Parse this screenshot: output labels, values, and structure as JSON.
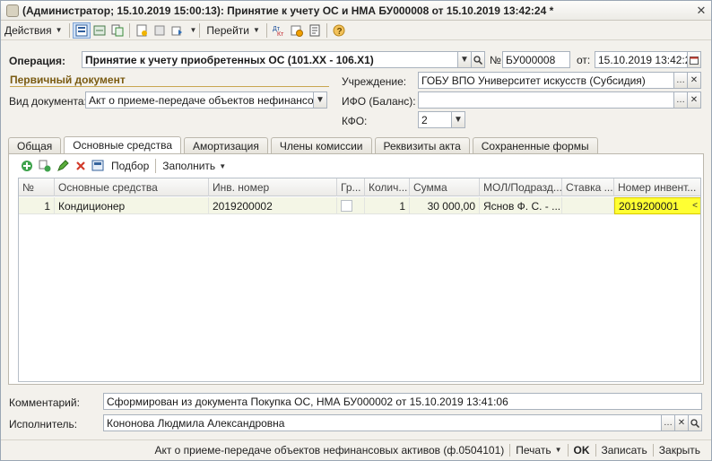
{
  "window": {
    "title": "(Администратор; 15.10.2019 15:00:13): Принятие к учету ОС и НМА БУ000008 от 15.10.2019 13:42:24 *"
  },
  "toolbar": {
    "actions_label": "Действия",
    "goto_label": "Перейти"
  },
  "header": {
    "operation_label": "Операция:",
    "operation_value": "Принятие к учету приобретенных ОС (101.ХХ - 106.Х1)",
    "number_label": "№",
    "number_value": "БУ000008",
    "date_label": "от:",
    "date_value": "15.10.2019 13:42:24"
  },
  "primary_doc": {
    "section_title": "Первичный документ",
    "doc_type_label": "Вид документа:",
    "doc_type_value": "Акт о приеме-передаче объектов нефинансовых"
  },
  "institution": {
    "label": "Учреждение:",
    "value": "ГОБУ ВПО Университет искусств (Субсидия)",
    "ifo_label": "ИФО (Баланс):",
    "ifo_value": "",
    "kfo_label": "КФО:",
    "kfo_value": "2"
  },
  "tabs": [
    {
      "label": "Общая"
    },
    {
      "label": "Основные средства"
    },
    {
      "label": "Амортизация"
    },
    {
      "label": "Члены комиссии"
    },
    {
      "label": "Реквизиты акта"
    },
    {
      "label": "Сохраненные формы"
    }
  ],
  "panel_toolbar": {
    "select_label": "Подбор",
    "fill_label": "Заполнить"
  },
  "table": {
    "columns": [
      "№",
      "Основные средства",
      "Инв. номер",
      "Гр...",
      "Колич...",
      "Сумма",
      "МОЛ/Подразд...",
      "Ставка ...",
      "Номер инвент..."
    ],
    "rows": [
      {
        "num": "1",
        "asset": "Кондиционер",
        "inv": "2019200002",
        "qty": "1",
        "sum": "30 000,00",
        "mol": "Яснов Ф. С. - ...",
        "rate": "",
        "invnum": "2019200001"
      }
    ]
  },
  "footer": {
    "comment_label": "Комментарий:",
    "comment_value": "Сформирован из документа Покупка ОС, НМА БУ000002 от 15.10.2019 13:41:06",
    "executor_label": "Исполнитель:",
    "executor_value": "Кононова Людмила Александровна"
  },
  "statusbar": {
    "act_label": "Акт о приеме-передаче объектов нефинансовых активов (ф.0504101)",
    "print_label": "Печать",
    "ok_label": "OK",
    "save_label": "Записать",
    "close_label": "Закрыть"
  },
  "colors": {
    "highlight": "#ffff33",
    "section_title": "#7a5b12",
    "selected_row": "#f4f6e6"
  }
}
